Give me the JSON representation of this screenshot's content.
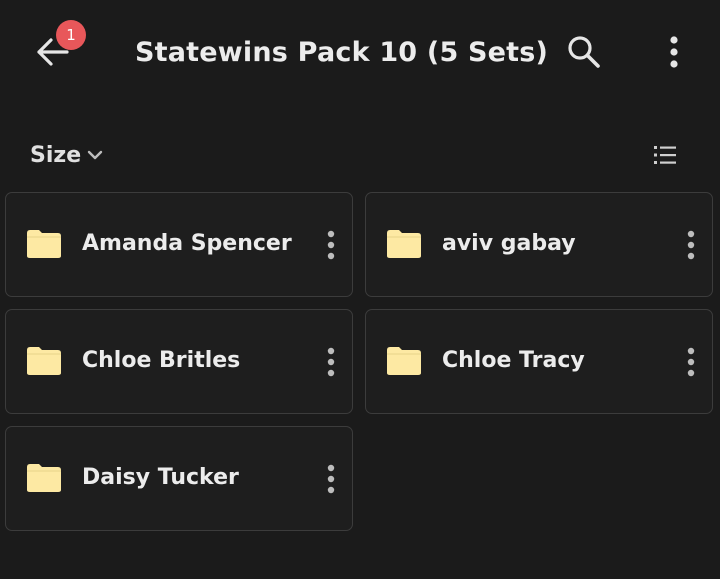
{
  "header": {
    "title": "Statewins Pack 10 (5 Sets)",
    "badge_count": "1",
    "back_icon": "arrow-left-icon",
    "search_icon": "search-icon",
    "more_icon": "more-vertical-icon"
  },
  "sort": {
    "label": "Size",
    "icon": "chevron-down-icon",
    "view_toggle_icon": "list-view-icon"
  },
  "folders": [
    {
      "name": "Amanda Spencer"
    },
    {
      "name": "aviv gabay"
    },
    {
      "name": "Chloe Britles"
    },
    {
      "name": "Chloe Tracy"
    },
    {
      "name": "Daisy Tucker"
    }
  ],
  "colors": {
    "background": "#1b1b1b",
    "card_border": "#3c3c3c",
    "folder": "#fde9a3",
    "badge": "#e8575a",
    "text": "#ececec"
  }
}
